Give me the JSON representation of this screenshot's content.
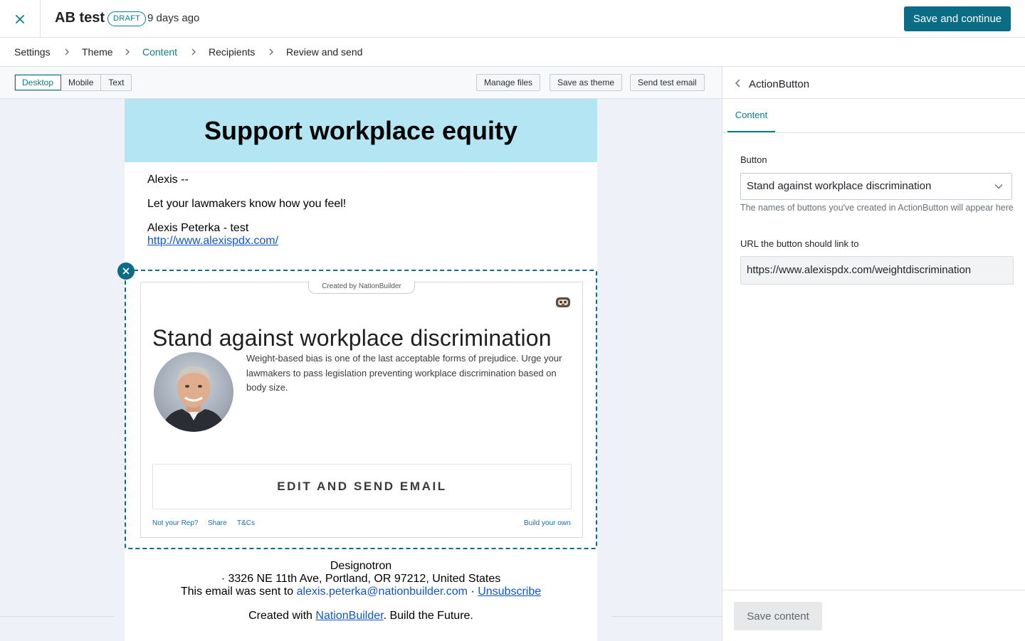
{
  "header": {
    "title": "AB test",
    "badge": "DRAFT",
    "timestamp": "9 days ago",
    "primary_button": "Save and continue"
  },
  "steps": [
    {
      "label": "Settings"
    },
    {
      "label": "Theme"
    },
    {
      "label": "Content",
      "active": true
    },
    {
      "label": "Recipients"
    },
    {
      "label": "Review and send"
    }
  ],
  "toolbar": {
    "view_modes": [
      "Desktop",
      "Mobile",
      "Text"
    ],
    "active_view": "Desktop",
    "manage_files": "Manage files",
    "save_theme": "Save as theme",
    "send_test": "Send test email"
  },
  "email": {
    "headline": "Support workplace equity",
    "greeting": "Alexis --",
    "message": "Let your lawmakers know how you feel!",
    "signature_name": "Alexis Peterka - test",
    "signature_link": "http://www.alexispdx.com/",
    "widget": {
      "created_by": "Created by NationBuilder",
      "title": "Stand against workplace discrimination",
      "description": "Weight-based bias is one of the last acceptable forms of prejudice. Urge your lawmakers to pass legislation preventing workplace discrimination based on body size.",
      "button": "EDIT AND SEND EMAIL",
      "links": {
        "not_rep": "Not your Rep?",
        "share": "Share",
        "tcs": "T&Cs",
        "build": "Build your own"
      }
    },
    "footer": {
      "org": "Designotron",
      "address": "· 3326 NE 11th Ave, Portland, OR 97212, United States",
      "sent_prefix": "This email was sent to",
      "sent_email": "alexis.peterka@nationbuilder.com",
      "separator": "·",
      "unsubscribe": "Unsubscribe",
      "created_prefix": "Created with",
      "created_link": "NationBuilder",
      "created_suffix": ". Build the Future."
    }
  },
  "panel": {
    "title": "ActionButton",
    "tab": "Content",
    "button_label": "Button",
    "button_value": "Stand against workplace discrimination",
    "button_help": "The names of buttons you've created in ActionButton will appear here",
    "url_label": "URL the button should link to",
    "url_value": "https://www.alexispdx.com/weightdiscrimination",
    "save": "Save content"
  },
  "colors": {
    "accent": "#0b7c8a",
    "primary_button": "#0b6c86",
    "header_band": "#b3e6f2",
    "canvas": "#eef1f8"
  }
}
